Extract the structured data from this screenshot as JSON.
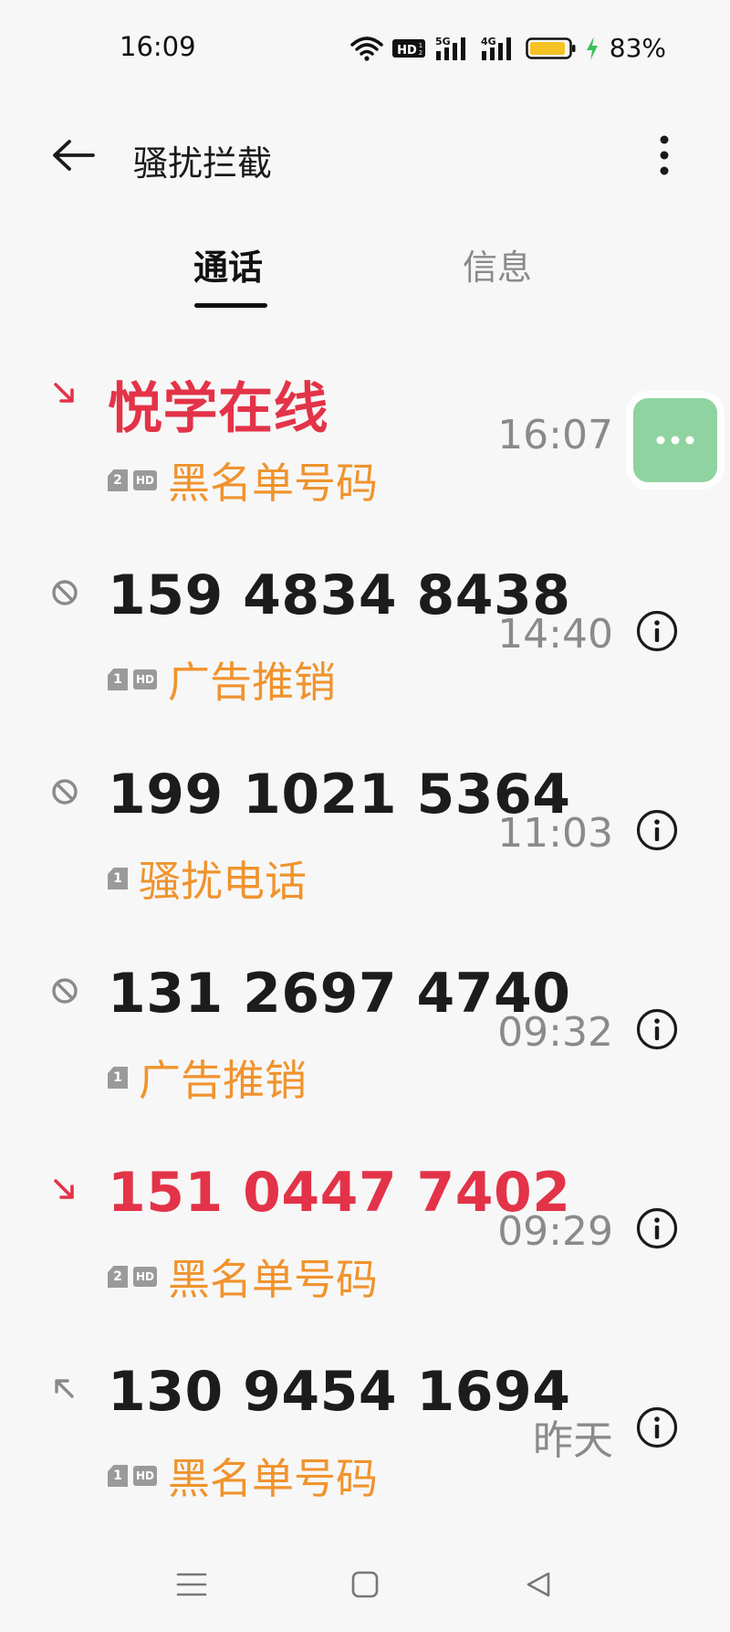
{
  "status_bar": {
    "time": "16:09",
    "hd_label": "HD",
    "signal1_label": "5G",
    "signal2_label": "4G",
    "battery": "83%",
    "icons": [
      "wifi-icon",
      "hd-voice-icon",
      "signal-5g-icon",
      "signal-4g-icon",
      "battery-icon",
      "charging-icon"
    ]
  },
  "header": {
    "title": "骚扰拦截",
    "back_icon": "arrow-left-icon",
    "more_icon": "more-vertical-icon"
  },
  "tabs": [
    {
      "label": "通话",
      "active": true
    },
    {
      "label": "信息",
      "active": false
    }
  ],
  "calls": [
    {
      "name": "悦学在线",
      "type": "incoming-blocked",
      "sim": "2",
      "hd": true,
      "label": "黑名单号码",
      "time": "16:07",
      "name_color": "#e33348"
    },
    {
      "name": "159 4834 8438",
      "type": "rejected",
      "sim": "1",
      "hd": true,
      "label": "广告推销",
      "time": "14:40",
      "name_color": "#1c1c1c"
    },
    {
      "name": "199 1021 5364",
      "type": "rejected",
      "sim": "1",
      "hd": false,
      "label": "骚扰电话",
      "time": "11:03",
      "name_color": "#1c1c1c"
    },
    {
      "name": "131 2697 4740",
      "type": "rejected",
      "sim": "1",
      "hd": false,
      "label": "广告推销",
      "time": "09:32",
      "name_color": "#1c1c1c"
    },
    {
      "name": "151 0447 7402",
      "type": "incoming-blocked",
      "sim": "2",
      "hd": true,
      "label": "黑名单号码",
      "time": "09:29",
      "name_color": "#e33348"
    },
    {
      "name": "130 9454 1694",
      "type": "outgoing",
      "sim": "1",
      "hd": true,
      "label": "黑名单号码",
      "time": "昨天",
      "name_color": "#1c1c1c"
    }
  ],
  "colors": {
    "accent_red": "#e33348",
    "label_orange": "#f0932d",
    "float_green": "#8fd3a0"
  },
  "nav": {
    "icons": [
      "menu-icon",
      "home-icon",
      "back-triangle-icon"
    ]
  }
}
